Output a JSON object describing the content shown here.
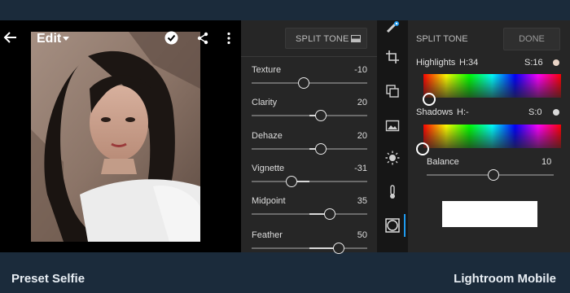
{
  "header": {
    "edit_label": "Edit",
    "icons": [
      "back-arrow-icon",
      "chevron-down-icon",
      "check-circle-icon",
      "share-icon",
      "more-vertical-icon"
    ]
  },
  "sliders_panel": {
    "tab_label": "SPLIT TONE",
    "items": [
      {
        "label": "Texture",
        "value": "-10",
        "numeric": -10
      },
      {
        "label": "Clarity",
        "value": "20",
        "numeric": 20
      },
      {
        "label": "Dehaze",
        "value": "20",
        "numeric": 20
      },
      {
        "label": "Vignette",
        "value": "-31",
        "numeric": -31
      },
      {
        "label": "Midpoint",
        "value": "35",
        "numeric": 35
      },
      {
        "label": "Feather",
        "value": "50",
        "numeric": 50
      }
    ]
  },
  "tool_rail": {
    "icons": [
      "auto-wand-icon",
      "crop-icon",
      "presets-icon",
      "photo-edit-icon",
      "light-icon",
      "temperature-icon",
      "effects-icon"
    ],
    "active": "effects-icon",
    "accent_color": "#1e9bf0"
  },
  "split_tone": {
    "title": "SPLIT TONE",
    "done_label": "DONE",
    "highlights": {
      "label": "Highlights",
      "hue": "H:34",
      "saturation": "S:16",
      "dot_color": "#e9d4c7"
    },
    "shadows": {
      "label": "Shadows",
      "hue": "H:-",
      "saturation": "S:0",
      "dot_color": "#d9d9d9"
    },
    "balance": {
      "label": "Balance",
      "value": "10"
    }
  },
  "footer": {
    "left": "Preset Selfie",
    "right": "Lightroom Mobile"
  }
}
